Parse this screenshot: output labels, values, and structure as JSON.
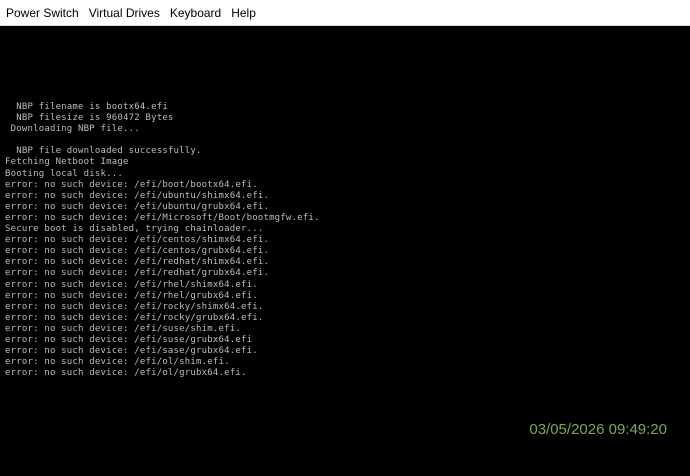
{
  "menubar": {
    "items": [
      {
        "label": "Power Switch"
      },
      {
        "label": "Virtual Drives"
      },
      {
        "label": "Keyboard"
      },
      {
        "label": "Help"
      }
    ]
  },
  "console": {
    "lines": [
      "  NBP filename is bootx64.efi",
      "  NBP filesize is 960472 Bytes",
      " Downloading NBP file...",
      "",
      "  NBP file downloaded successfully.",
      "Fetching Netboot Image",
      "Booting local disk...",
      "error: no such device: /efi/boot/bootx64.efi.",
      "error: no such device: /efi/ubuntu/shimx64.efi.",
      "error: no such device: /efi/ubuntu/grubx64.efi.",
      "error: no such device: /efi/Microsoft/Boot/bootmgfw.efi.",
      "Secure boot is disabled, trying chainloader...",
      "error: no such device: /efi/centos/shimx64.efi.",
      "error: no such device: /efi/centos/grubx64.efi.",
      "error: no such device: /efi/redhat/shimx64.efi.",
      "error: no such device: /efi/redhat/grubx64.efi.",
      "error: no such device: /efi/rhel/shimx64.efi.",
      "error: no such device: /efi/rhel/grubx64.efi.",
      "error: no such device: /efi/rocky/shimx64.efi.",
      "error: no such device: /efi/rocky/grubx64.efi.",
      "error: no such device: /efi/suse/shim.efi.",
      "error: no such device: /efi/suse/grubx64.efi",
      "error: no such device: /efi/sase/grubx64.efi.",
      "error: no such device: /efi/ol/shim.efi.",
      "error: no such device: /efi/ol/grubx64.efi."
    ]
  },
  "status": {
    "timestamp": "03/05/2026 09:49:20"
  },
  "colors": {
    "console_text": "#bdbdbd",
    "timestamp": "#7fa845",
    "background": "#000000"
  }
}
